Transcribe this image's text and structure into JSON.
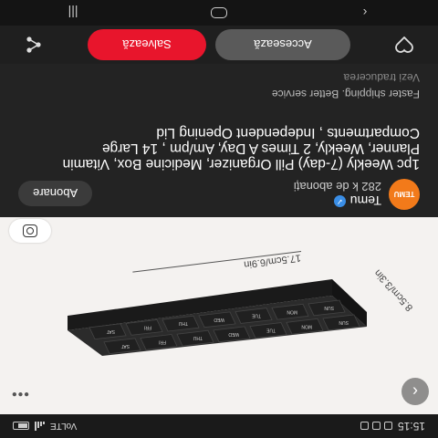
{
  "status_bar": {
    "time": "15:15",
    "network": "VoLTE"
  },
  "product": {
    "width_label": "17.5cm/6.9in",
    "depth_label": "8.5cm/3.3in",
    "day_labels": [
      "SUN",
      "MON",
      "TUE",
      "WED",
      "THU",
      "FRI",
      "SAT"
    ]
  },
  "channel": {
    "logo_text": "TEMU",
    "name": "Temu",
    "subscribers": "282 k de abonați",
    "subscribe_label": "Abonare"
  },
  "video": {
    "title": "1pc Weekly (7-day) Pill Organizer, Medicine Box, Vitamin Planner, Weekly, 2 Times A Day, Am/pm , 14 Large Compartments , Independent Opening Lid",
    "tagline": "Faster shipping. Better service",
    "translate_label": "Vezi traducerea"
  },
  "actions": {
    "access_label": "Accesează",
    "save_label": "Salvează"
  },
  "icons": {
    "back": "chevron-left-icon",
    "more": "more-horizontal-icon",
    "lens": "lens-scan-icon",
    "favorite": "heart-icon",
    "share": "share-icon"
  },
  "colors": {
    "save": "#e8152c",
    "temu": "#f27a1a",
    "verified": "#3a8ee6"
  }
}
